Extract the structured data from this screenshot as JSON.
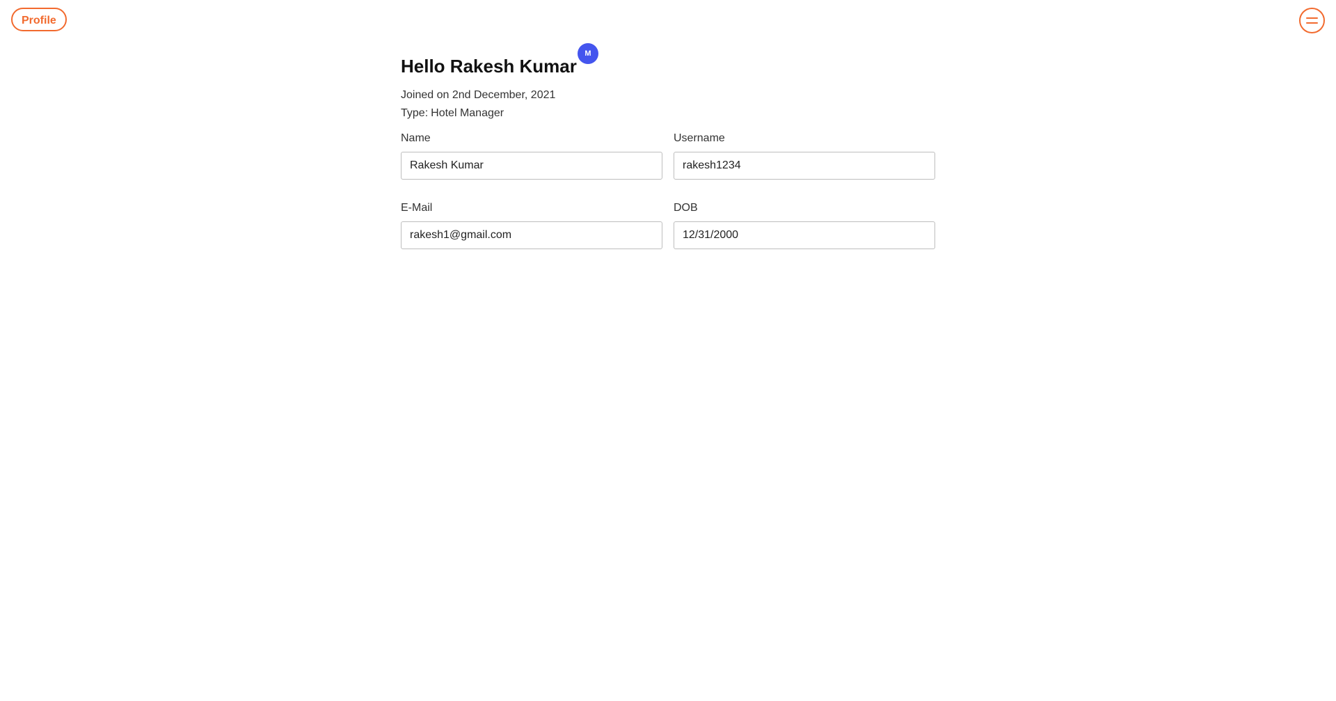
{
  "header": {
    "profile_label": "Profile",
    "menu_icon": "hamburger-menu-icon"
  },
  "colors": {
    "accent": "#f26a2e",
    "badge": "#4455ee"
  },
  "user": {
    "greeting": "Hello Rakesh Kumar",
    "badge_letter": "M",
    "joined": "Joined on 2nd December, 2021",
    "type_label": "Type:",
    "type_value": "Hotel Manager"
  },
  "form": {
    "name_label": "Name",
    "name_value": "Rakesh Kumar",
    "username_label": "Username",
    "username_value": "rakesh1234",
    "email_label": "E-Mail",
    "email_value": "rakesh1@gmail.com",
    "dob_label": "DOB",
    "dob_value": "12/31/2000"
  }
}
